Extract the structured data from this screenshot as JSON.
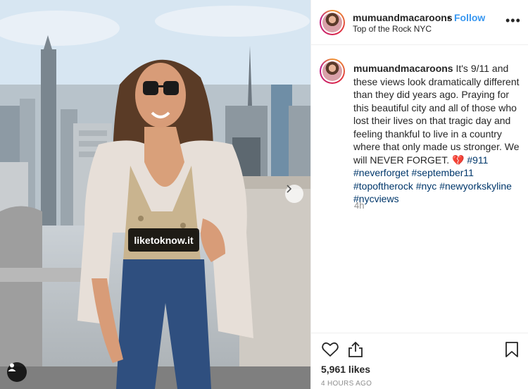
{
  "post": {
    "username": "mumuandmacaroons",
    "follow_label": "Follow",
    "separator": "•",
    "location": "Top of the Rock NYC",
    "more_icon": "ellipsis-icon"
  },
  "photo": {
    "tag_label": "liketoknow.it",
    "carousel_icon": "chevron-right-icon",
    "user_tag_icon": "person-icon"
  },
  "caption": {
    "username": "mumuandmacaroons",
    "text": "It's 9/11 and these views look dramatically different than they did years ago. Praying for this beautiful city and all of those who lost their lives on that tragic day and feeling thankful to live in a country where that only made us stronger. We will NEVER FORGET. 💔",
    "hashtags": [
      "#911",
      "#neverforget",
      "#september11",
      "#topoftherock",
      "#nyc",
      "#newyorkskyline",
      "#nycviews"
    ],
    "time_ago": "4h"
  },
  "actions": {
    "like_icon": "heart-icon",
    "share_icon": "share-icon",
    "save_icon": "bookmark-icon",
    "likes": "5,961 likes",
    "timestamp": "4 HOURS AGO"
  },
  "colors": {
    "link": "#3897f0",
    "hashtag": "#00376b",
    "muted": "#8e8e8e",
    "text": "#262626"
  }
}
